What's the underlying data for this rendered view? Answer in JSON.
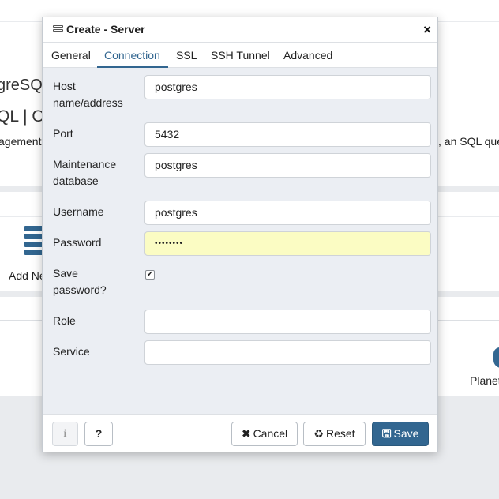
{
  "background": {
    "heading_partial": "greSQ",
    "subheading_partial": "QL | Op",
    "desc_left_partial": "agement",
    "desc_right_partial": ", an SQL que",
    "add_new_partial": "Add Ne",
    "planet_partial": "Planet"
  },
  "dialog": {
    "title": "Create - Server",
    "close_glyph": "×",
    "tabs": [
      {
        "label": "General"
      },
      {
        "label": "Connection"
      },
      {
        "label": "SSL"
      },
      {
        "label": "SSH Tunnel"
      },
      {
        "label": "Advanced"
      }
    ],
    "active_tab": "Connection",
    "fields": {
      "host": {
        "label": "Host name/address",
        "value": "postgres"
      },
      "port": {
        "label": "Port",
        "value": "5432"
      },
      "maintenance_db": {
        "label": "Maintenance database",
        "value": "postgres"
      },
      "username": {
        "label": "Username",
        "value": "postgres"
      },
      "password": {
        "label": "Password",
        "value": "••••••••"
      },
      "save_password": {
        "label": "Save password?",
        "checked": true,
        "glyph": "✔"
      },
      "role": {
        "label": "Role",
        "value": ""
      },
      "service": {
        "label": "Service",
        "value": ""
      }
    },
    "footer": {
      "info_glyph": "i",
      "help_glyph": "?",
      "cancel_icon": "✖",
      "cancel_label": "Cancel",
      "reset_icon": "♻",
      "reset_label": "Reset",
      "save_icon": "🖫",
      "save_label": "Save"
    }
  },
  "colors": {
    "accent": "#326690",
    "password_fill": "#fbfcc3",
    "dialog_bg": "#ebeef3"
  }
}
